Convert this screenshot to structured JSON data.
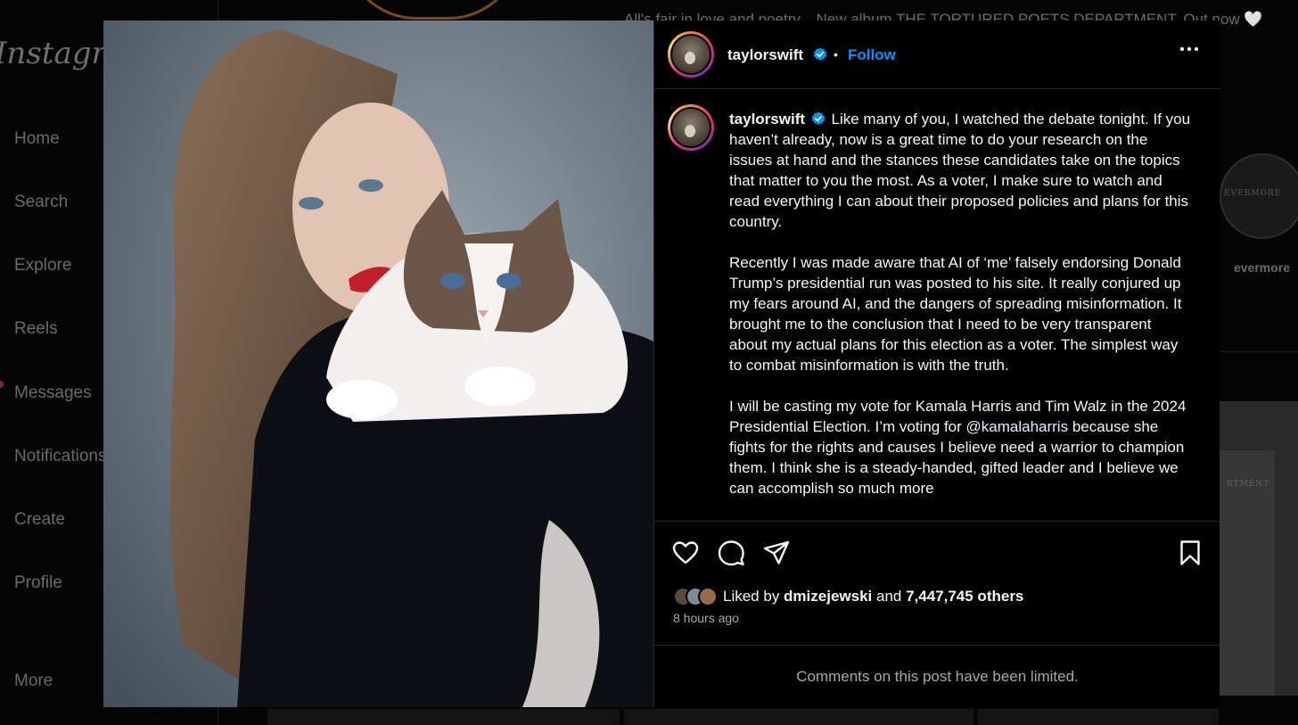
{
  "background": {
    "logo": "Instagram",
    "nav": [
      "Home",
      "Search",
      "Explore",
      "Reels",
      "Messages",
      "Notifications",
      "Create",
      "Profile"
    ],
    "more_label": "More",
    "bio": "All's fair in love and poetry... New album THE TORTURED POETS DEPARTMENT. Out now 🤍",
    "highlight_text": "EVERMORE",
    "highlight_label": "evermore",
    "tile_text": "RTMENT"
  },
  "post": {
    "username": "taylorswift",
    "verified": true,
    "follow_label": "Follow",
    "caption": {
      "username": "taylorswift",
      "paragraphs": [
        "Like many of you, I watched the debate tonight. If you haven’t already, now is a great time to do your research on the issues at hand and the stances these candidates take on the topics that matter to you the most. As a voter, I make sure to watch and read everything I can about their proposed policies and plans for this country.",
        "Recently I was made aware that AI of ‘me’ falsely endorsing Donald Trump’s presidential run was posted to his site. It really conjured up my fears around AI, and the dangers of spreading misinformation. It brought me to the conclusion that I need to be very transparent about my actual plans for this election as a voter. The simplest way to combat misinformation is with the truth."
      ],
      "p3_before": "I will be casting my vote for Kamala Harris and Tim Walz in the 2024 Presidential Election. I’m voting for ",
      "p3_mention": "@kamalaharris",
      "p3_after": " because she fights for the rights and causes I believe need a warrior to champion them. I think she is a steady-handed, gifted leader and I believe we can accomplish so much more"
    },
    "likes": {
      "prefix": "Liked by ",
      "user": "dmizejewski",
      "middle": " and ",
      "count": "7,447,745 others"
    },
    "time": "8 hours ago",
    "comments_notice": "Comments on this post have been limited."
  },
  "colors": {
    "accent": "#0095f6",
    "verified": "#0095f6"
  },
  "icons": [
    "heart-icon",
    "comment-icon",
    "share-icon",
    "bookmark-icon",
    "more-icon",
    "verified-icon"
  ]
}
